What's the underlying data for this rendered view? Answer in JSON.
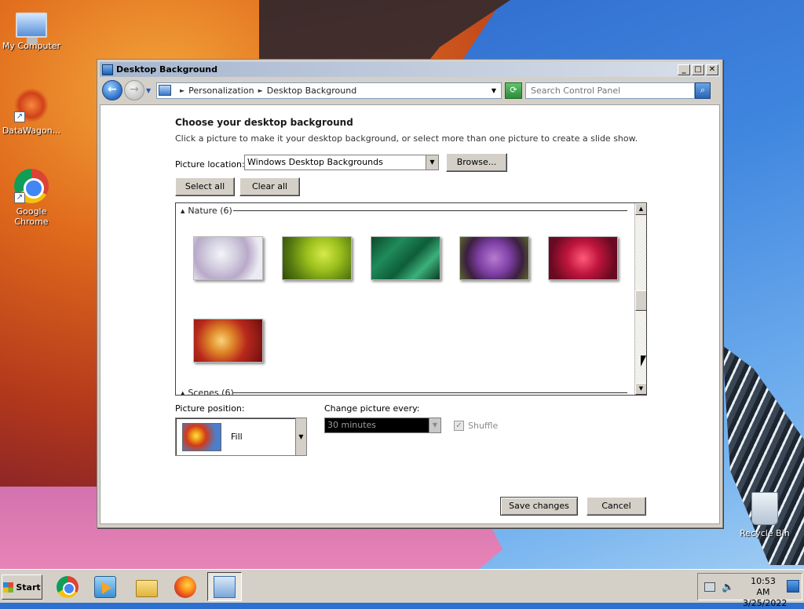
{
  "desktop": {
    "icons": [
      {
        "label": "My Computer",
        "icon": "my-computer-icon"
      },
      {
        "label": "DataWagon...",
        "icon": "datawagon-icon"
      },
      {
        "label": "Google Chrome",
        "icon": "chrome-icon"
      },
      {
        "label": "Recycle Bin",
        "icon": "recycle-bin-icon"
      }
    ]
  },
  "window": {
    "title": "Desktop Background",
    "controls": {
      "minimize": "_",
      "maximize": "□",
      "close": "✕"
    },
    "address": {
      "crumbs": [
        "Personalization",
        "Desktop Background"
      ],
      "search_placeholder": "Search Control Panel"
    },
    "content": {
      "heading": "Choose your desktop background",
      "subtext": "Click a picture to make it your desktop background, or select more than one picture to create a slide show.",
      "picture_location_label": "Picture location:",
      "picture_location_value": "Windows Desktop Backgrounds",
      "browse_label": "Browse...",
      "select_all_label": "Select all",
      "clear_all_label": "Clear all",
      "groups": [
        {
          "name": "Nature (6)",
          "thumbnails": [
            "dandelion",
            "green-succulent",
            "green-leaves",
            "purple-thistle",
            "red-dahlia",
            "autumn-leaves"
          ]
        },
        {
          "name": "Scenes (6)"
        }
      ],
      "picture_position_label": "Picture position:",
      "picture_position_value": "Fill",
      "change_every_label": "Change picture every:",
      "change_every_value": "30 minutes",
      "shuffle_label": "Shuffle",
      "shuffle_checked": true,
      "save_label": "Save changes",
      "cancel_label": "Cancel"
    }
  },
  "taskbar": {
    "start_label": "Start",
    "apps": [
      "chrome-icon",
      "media-player-icon",
      "file-explorer-icon",
      "firefox-icon",
      "control-panel-icon"
    ],
    "clock_time": "10:53 AM",
    "clock_date": "3/25/2022"
  }
}
